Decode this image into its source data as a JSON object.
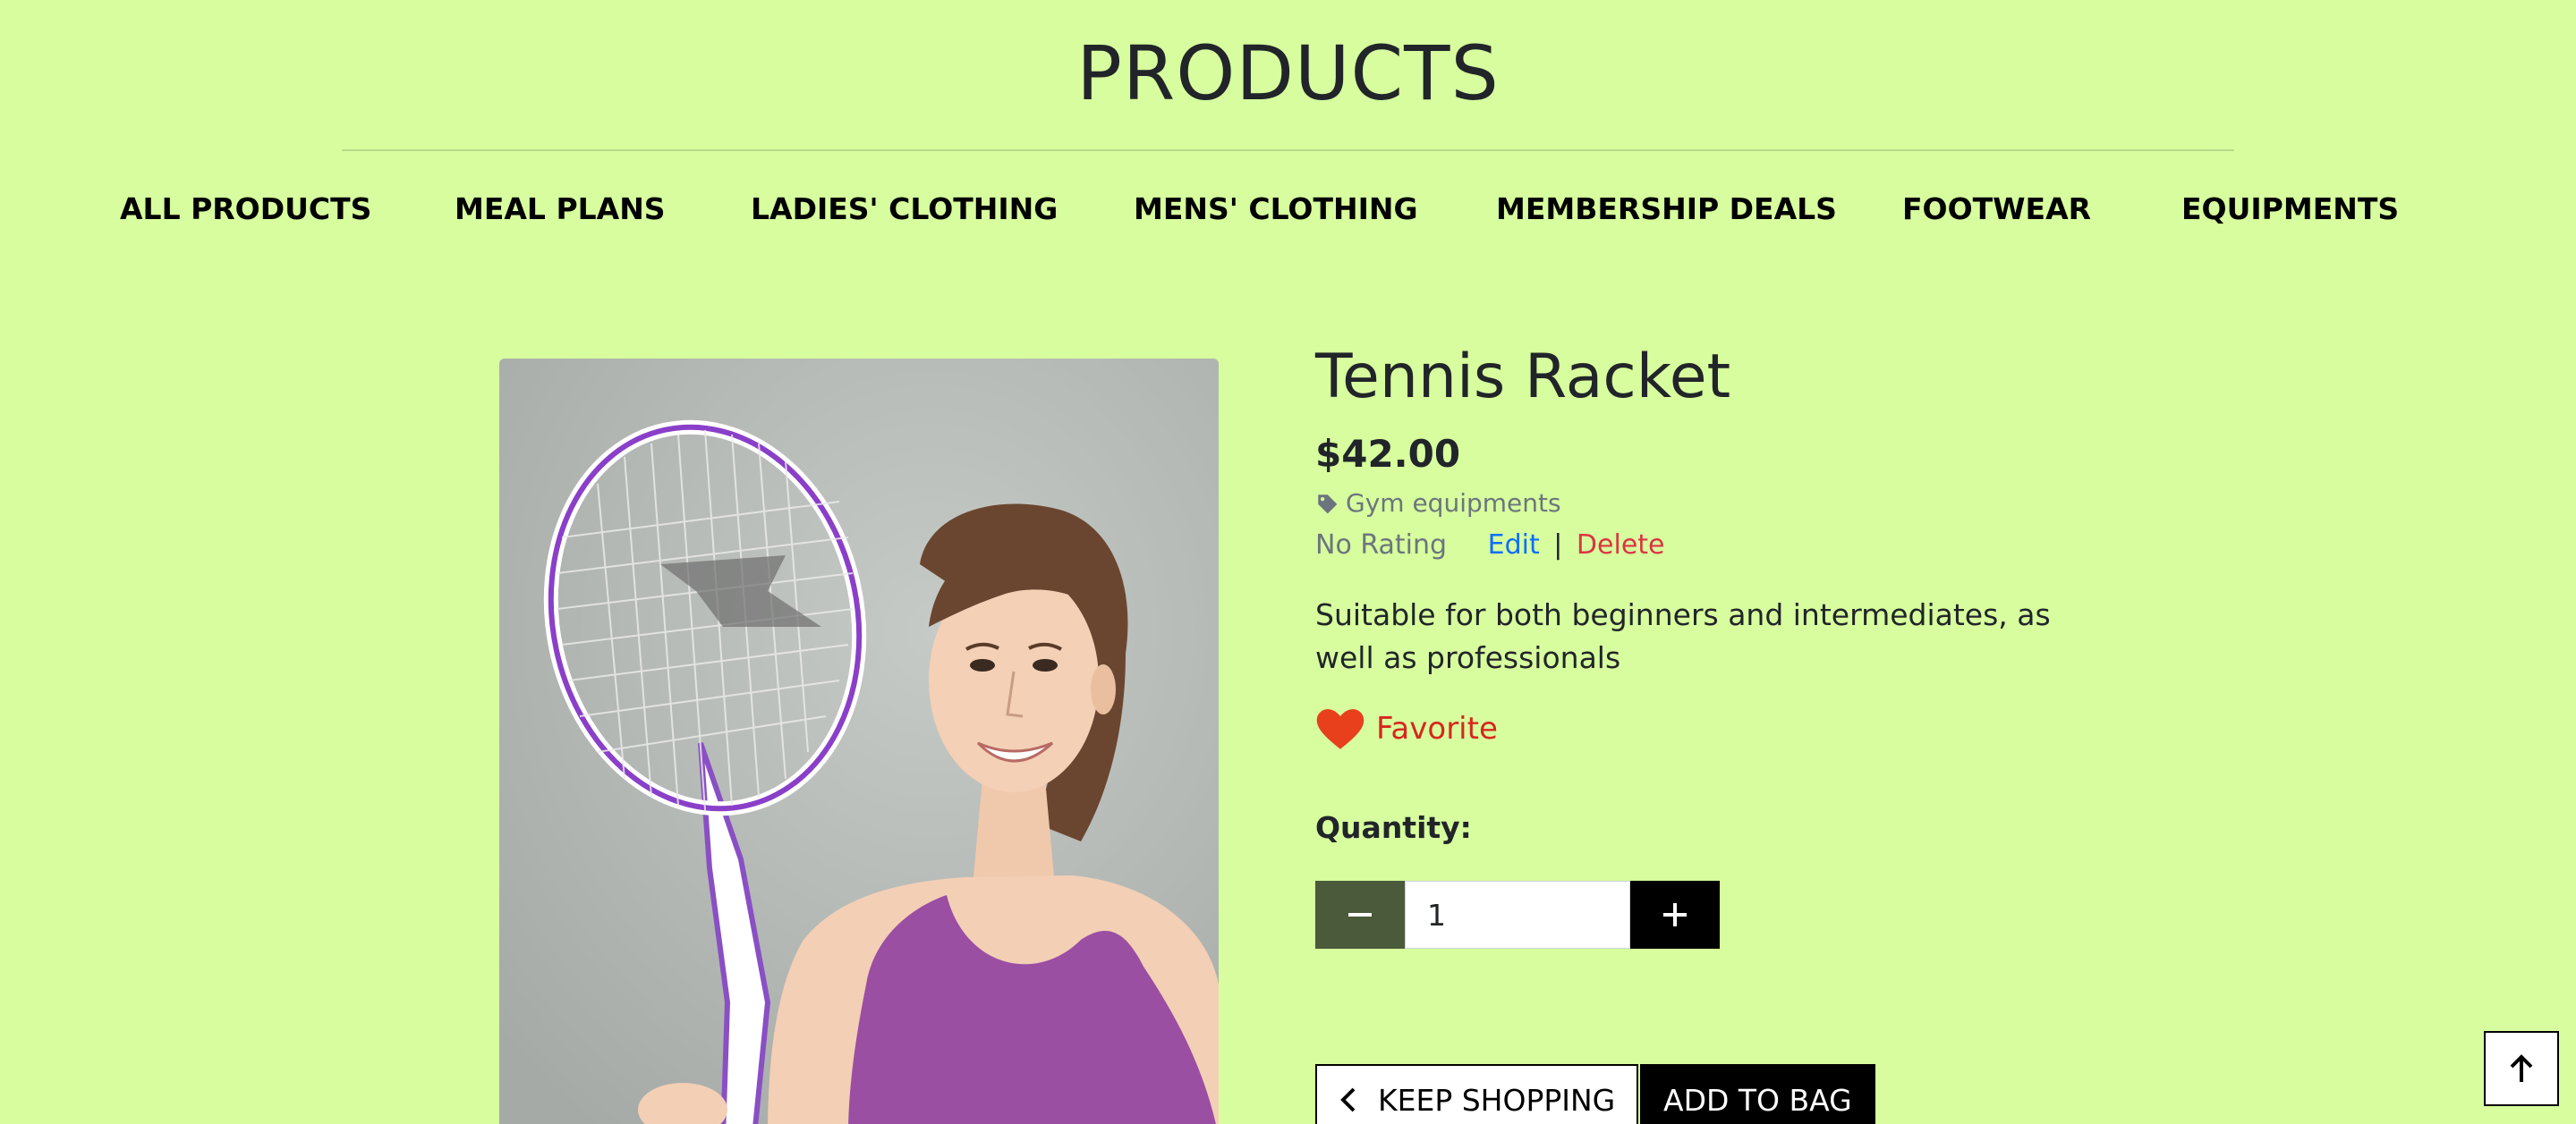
{
  "page_title": "PRODUCTS",
  "nav": {
    "items": [
      {
        "label": "ALL PRODUCTS"
      },
      {
        "label": "MEAL PLANS"
      },
      {
        "label": "LADIES' CLOTHING"
      },
      {
        "label": "MENS' CLOTHING"
      },
      {
        "label": "MEMBERSHIP DEALS"
      },
      {
        "label": "FOOTWEAR"
      },
      {
        "label": "EQUIPMENTS"
      }
    ]
  },
  "product": {
    "name": "Tennis Racket",
    "price": "$42.00",
    "category": "Gym equipments",
    "category_icon": "tag-icon",
    "rating": "No Rating",
    "edit_label": "Edit",
    "separator": "|",
    "delete_label": "Delete",
    "description": "Suitable for both beginners and intermediates, as well as professionals",
    "favorite_label": "Favorite",
    "favorite_icon": "heart-icon",
    "image_description": "Woman in purple tank top holding a white and purple tennis racket",
    "colors": {
      "background": "#d7fd9e",
      "favorite": "#d7261e",
      "edit": "#0d6efd",
      "delete": "#dc3545",
      "minus_button": "#4b5a3a",
      "plus_button": "#000000"
    }
  },
  "quantity": {
    "label": "Quantity:",
    "value": "1",
    "minus_icon": "minus-icon",
    "plus_icon": "plus-icon"
  },
  "actions": {
    "keep_shopping_label": "KEEP SHOPPING",
    "keep_shopping_icon": "chevron-left-icon",
    "add_to_bag_label": "ADD TO BAG"
  },
  "back_to_top_icon": "arrow-up-icon"
}
